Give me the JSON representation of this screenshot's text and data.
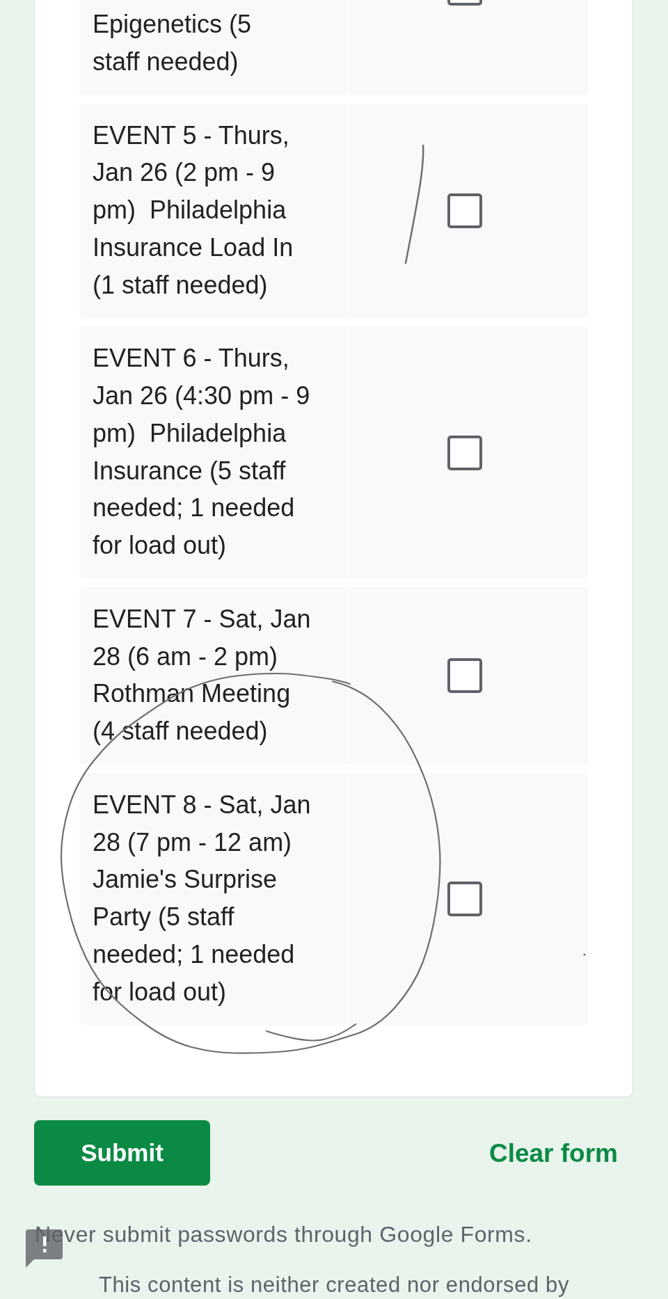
{
  "form": {
    "options": [
      {
        "label": "Epigenetics (5 staff needed)",
        "checked": false,
        "cut_off": true
      },
      {
        "label": "EVENT 5 - Thurs, Jan 26 (2 pm - 9 pm)  Philadelphia Insurance Load In (1 staff needed)",
        "checked": false,
        "cut_off": false
      },
      {
        "label": "EVENT 6 - Thurs, Jan 26 (4:30 pm - 9 pm)  Philadelphia Insurance (5 staff needed; 1 needed for load out)",
        "checked": false,
        "cut_off": false
      },
      {
        "label": "EVENT 7 - Sat, Jan 28 (6 am - 2 pm) Rothman Meeting (4 staff needed)",
        "checked": false,
        "cut_off": false
      },
      {
        "label": "EVENT 8 - Sat, Jan 28 (7 pm - 12 am) Jamie's Surprise Party (5 staff needed; 1 needed for load out)",
        "checked": false,
        "cut_off": false
      }
    ]
  },
  "actions": {
    "submit": "Submit",
    "clear": "Clear form"
  },
  "footer": {
    "warning": "Never submit passwords through Google Forms.",
    "disclaimer": "This content is neither created nor endorsed by"
  }
}
